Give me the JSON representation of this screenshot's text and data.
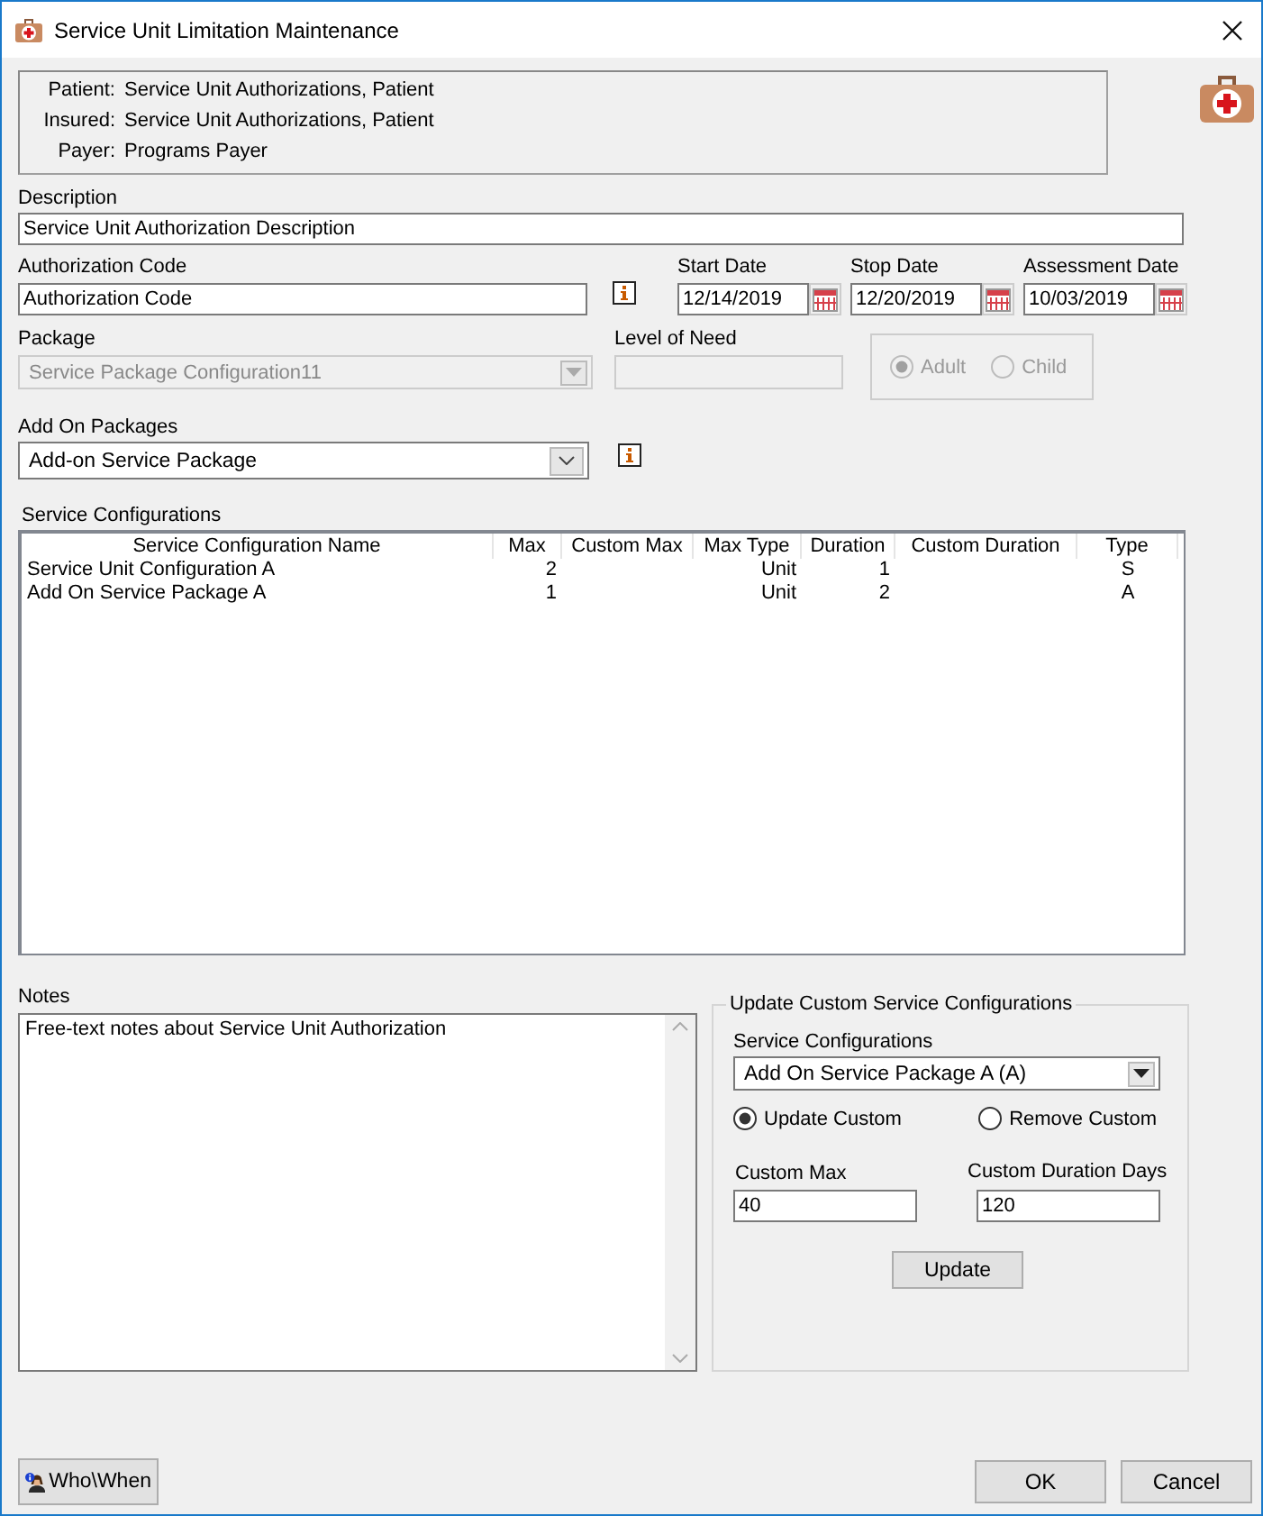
{
  "window": {
    "title": "Service Unit Limitation Maintenance"
  },
  "header": [
    {
      "label": "Patient:",
      "value": "Service Unit Authorizations, Patient"
    },
    {
      "label": "Insured:",
      "value": "Service Unit Authorizations, Patient"
    },
    {
      "label": "Payer:",
      "value": "Programs Payer"
    }
  ],
  "description": {
    "label": "Description",
    "value": "Service Unit Authorization Description"
  },
  "authorization_code": {
    "label": "Authorization Code",
    "value": "Authorization Code"
  },
  "dates": [
    {
      "label": "Start Date",
      "value": "12/14/2019"
    },
    {
      "label": "Stop Date",
      "value": "12/20/2019"
    },
    {
      "label": "Assessment Date",
      "value": "10/03/2019"
    }
  ],
  "package": {
    "label": "Package",
    "value": "Service Package Configuration11",
    "disabled": true
  },
  "level_of_need": {
    "label": "Level of Need",
    "disabled": true
  },
  "age_group": {
    "disabled": true,
    "options": [
      {
        "label": "Adult",
        "selected": true
      },
      {
        "label": "Child",
        "selected": false
      }
    ]
  },
  "add_on_packages": {
    "label": "Add On Packages",
    "value": "Add-on Service Package"
  },
  "service_configurations": {
    "label": "Service Configurations",
    "columns": [
      "Service Configuration Name",
      "Max",
      "Custom Max",
      "Max Type",
      "Duration",
      "Custom Duration",
      "Type"
    ],
    "rows": [
      {
        "service_configuration_name": "Service Unit Configuration A",
        "max": "2",
        "max_type": "Unit",
        "duration": "1",
        "type": "S"
      },
      {
        "service_configuration_name": "Add On Service Package A",
        "max": "1",
        "max_type": "Unit",
        "duration": "2",
        "type": "A"
      }
    ]
  },
  "notes": {
    "label": "Notes",
    "value": "Free-text notes about Service Unit Authorization"
  },
  "update_panel": {
    "title": "Update Custom Service Configurations",
    "combo_label": "Service Configurations",
    "combo_value": "Add On Service Package A (A)",
    "modes": [
      {
        "label": "Update Custom",
        "selected": true
      },
      {
        "label": "Remove Custom",
        "selected": false
      }
    ],
    "custom_max": {
      "label": "Custom Max",
      "value": "40"
    },
    "custom_duration": {
      "label": "Custom Duration Days",
      "value": "120"
    },
    "button": "Update"
  },
  "footer": {
    "who_when": "Who\\When",
    "buttons": [
      "OK",
      "Cancel"
    ]
  }
}
